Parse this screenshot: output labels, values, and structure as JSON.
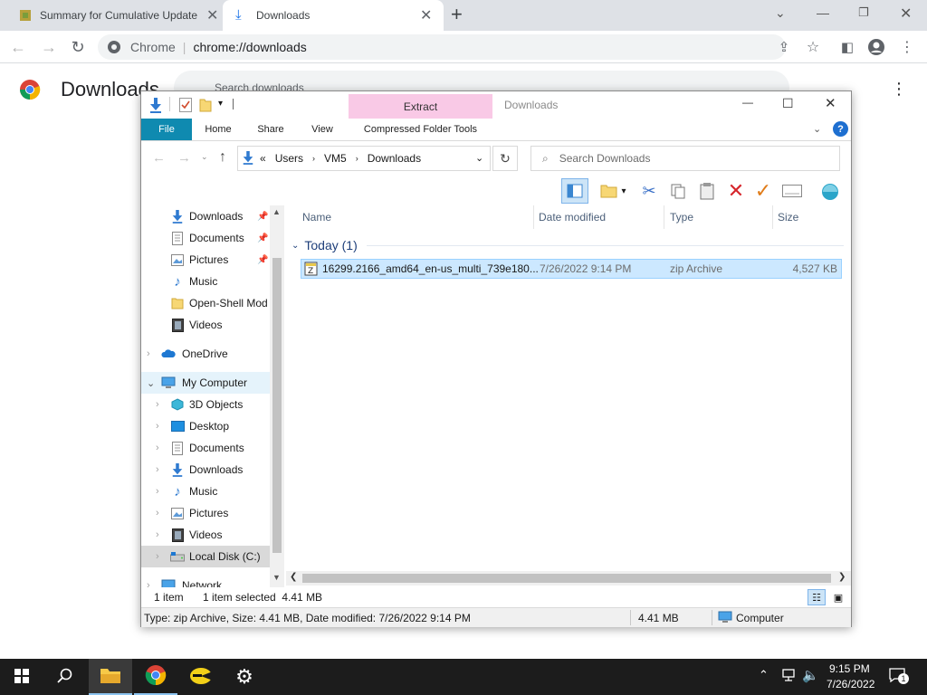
{
  "chrome": {
    "tabs": [
      {
        "title": "Summary for Cumulative Update"
      },
      {
        "title": "Downloads"
      }
    ],
    "new_tab_symbol": "+",
    "omnibox_site": "Chrome",
    "omnibox_url": "chrome://downloads",
    "page_title": "Downloads",
    "search_placeholder": "Search downloads"
  },
  "explorer": {
    "title": "Downloads",
    "contextual_tab": "Extract",
    "ribbon_tabs": [
      "File",
      "Home",
      "Share",
      "View",
      "Compressed Folder Tools"
    ],
    "breadcrumb_prefix": "«",
    "breadcrumb": [
      "Users",
      "VM5",
      "Downloads"
    ],
    "search_placeholder": "Search Downloads",
    "nav": {
      "quick_access": [
        {
          "label": "Downloads",
          "icon": "download-arrow-icon",
          "pinned": true
        },
        {
          "label": "Documents",
          "icon": "document-icon",
          "pinned": true
        },
        {
          "label": "Pictures",
          "icon": "pictures-icon",
          "pinned": true
        },
        {
          "label": "Music",
          "icon": "music-icon",
          "pinned": false
        },
        {
          "label": "Open-Shell Mod",
          "icon": "folder-icon",
          "pinned": false
        },
        {
          "label": "Videos",
          "icon": "videos-icon",
          "pinned": false
        }
      ],
      "onedrive": "OneDrive",
      "my_computer": "My Computer",
      "computer_children": [
        {
          "label": "3D Objects",
          "icon": "3d-objects-icon"
        },
        {
          "label": "Desktop",
          "icon": "desktop-icon"
        },
        {
          "label": "Documents",
          "icon": "document-icon"
        },
        {
          "label": "Downloads",
          "icon": "download-arrow-icon"
        },
        {
          "label": "Music",
          "icon": "music-icon"
        },
        {
          "label": "Pictures",
          "icon": "pictures-icon"
        },
        {
          "label": "Videos",
          "icon": "videos-icon"
        },
        {
          "label": "Local Disk (C:)",
          "icon": "drive-icon"
        }
      ],
      "network": "Network"
    },
    "columns": [
      "Name",
      "Date modified",
      "Type",
      "Size"
    ],
    "group_label": "Today (1)",
    "files": [
      {
        "name": "16299.2166_amd64_en-us_multi_739e180...",
        "date": "7/26/2022 9:14 PM",
        "type": "zip Archive",
        "size": "4,527 KB",
        "selected": true
      }
    ],
    "status": {
      "count": "1 item",
      "selected": "1 item selected  4.41 MB"
    },
    "details": {
      "text": "Type: zip Archive, Size: 4.41 MB, Date modified: 7/26/2022 9:14 PM",
      "size": "4.41 MB",
      "location": "Computer"
    }
  },
  "taskbar": {
    "time": "9:15 PM",
    "date": "7/26/2022",
    "notification_count": "1"
  },
  "colors": {
    "file_tab": "#0f8ab0",
    "extract_tab": "#f9c9e6",
    "selection": "#cce8ff",
    "taskbar": "#1c1c1c"
  }
}
